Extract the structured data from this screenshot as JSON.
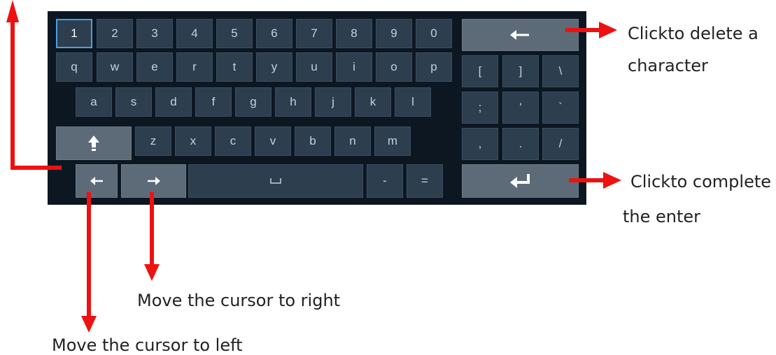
{
  "keyboard": {
    "rows": [
      [
        "1",
        "2",
        "3",
        "4",
        "5",
        "6",
        "7",
        "8",
        "9",
        "0"
      ],
      [
        "q",
        "w",
        "e",
        "r",
        "t",
        "y",
        "u",
        "i",
        "o",
        "p"
      ],
      [
        "a",
        "s",
        "d",
        "f",
        "g",
        "h",
        "j",
        "k",
        "l"
      ],
      [
        "z",
        "x",
        "c",
        "v",
        "b",
        "n",
        "m"
      ]
    ],
    "symbols": [
      [
        "[",
        "]",
        "\\"
      ],
      [
        ";",
        "'",
        "`"
      ],
      [
        ",",
        ".",
        "/"
      ]
    ],
    "bottom": {
      "minus": "-",
      "equals": "="
    },
    "selected_key": "1"
  },
  "colors": {
    "background": "#0c1722",
    "key": "#2d3f4f",
    "special_key": "#5d6b78",
    "annotation_arrow": "#ee1111",
    "selection": "#4a9fe0"
  },
  "annotations": {
    "delete_line1": "Clickto delete a",
    "delete_line2": "character",
    "enter_line1": "Clickto complete",
    "enter_line2": "the enter",
    "cursor_right": "Move the cursor to right",
    "cursor_left": "Move the cursor to left"
  }
}
